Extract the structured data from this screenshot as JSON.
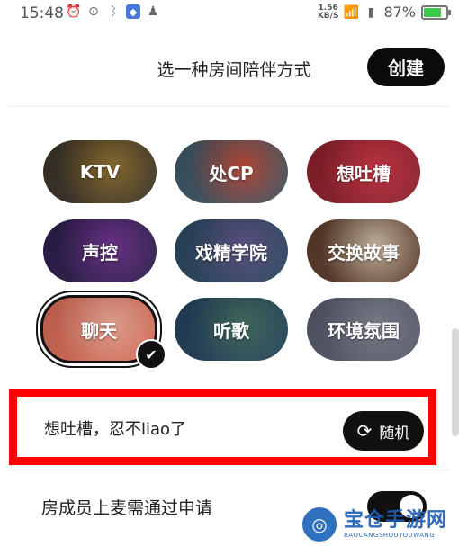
{
  "status_bar": {
    "time": "15:48",
    "net_speed": "1.56",
    "net_unit": "KB/S",
    "battery": "87%",
    "icons_left": [
      "alarm-icon",
      "location-icon",
      "bluetooth-icon",
      "shield-icon",
      "qq-icon"
    ],
    "battery_level": 0.87
  },
  "header": {
    "title": "选一种房间陪伴方式",
    "create_label": "创建"
  },
  "tiles": [
    {
      "label": "KTV",
      "bg": "#3a3226",
      "accent": "#8a6a2a",
      "selected": false
    },
    {
      "label": "处CP",
      "bg": "#3c5563",
      "accent": "#b84432",
      "selected": false
    },
    {
      "label": "想吐槽",
      "bg": "#8a1f2a",
      "accent": "#c43040",
      "selected": false
    },
    {
      "label": "声控",
      "bg": "#2c1d4a",
      "accent": "#6a2e8a",
      "selected": false
    },
    {
      "label": "戏精学院",
      "bg": "#2b4660",
      "accent": "#5a4f80",
      "selected": false
    },
    {
      "label": "交换故事",
      "bg": "#5a3a2a",
      "accent": "#c8b8a0",
      "selected": false
    },
    {
      "label": "聊天",
      "bg": "#d46a55",
      "accent": "#e9a493",
      "selected": true
    },
    {
      "label": "听歌",
      "bg": "#23405a",
      "accent": "#3e6a5a",
      "selected": false
    },
    {
      "label": "环境氛围",
      "bg": "#55596a",
      "accent": "#7a7e8a",
      "selected": false
    }
  ],
  "topic": {
    "text": "想吐槽，忍不liao了",
    "random_label": "随机"
  },
  "settings": {
    "apply_label": "房成员上麦需通过申请",
    "apply_enabled": true
  },
  "watermark": {
    "title": "宝仓手游网",
    "subtitle": "BAOCANGSHOUYOUWANG"
  },
  "colors": {
    "accent_dark": "#0b0b0b",
    "highlight": "#ff0000"
  }
}
